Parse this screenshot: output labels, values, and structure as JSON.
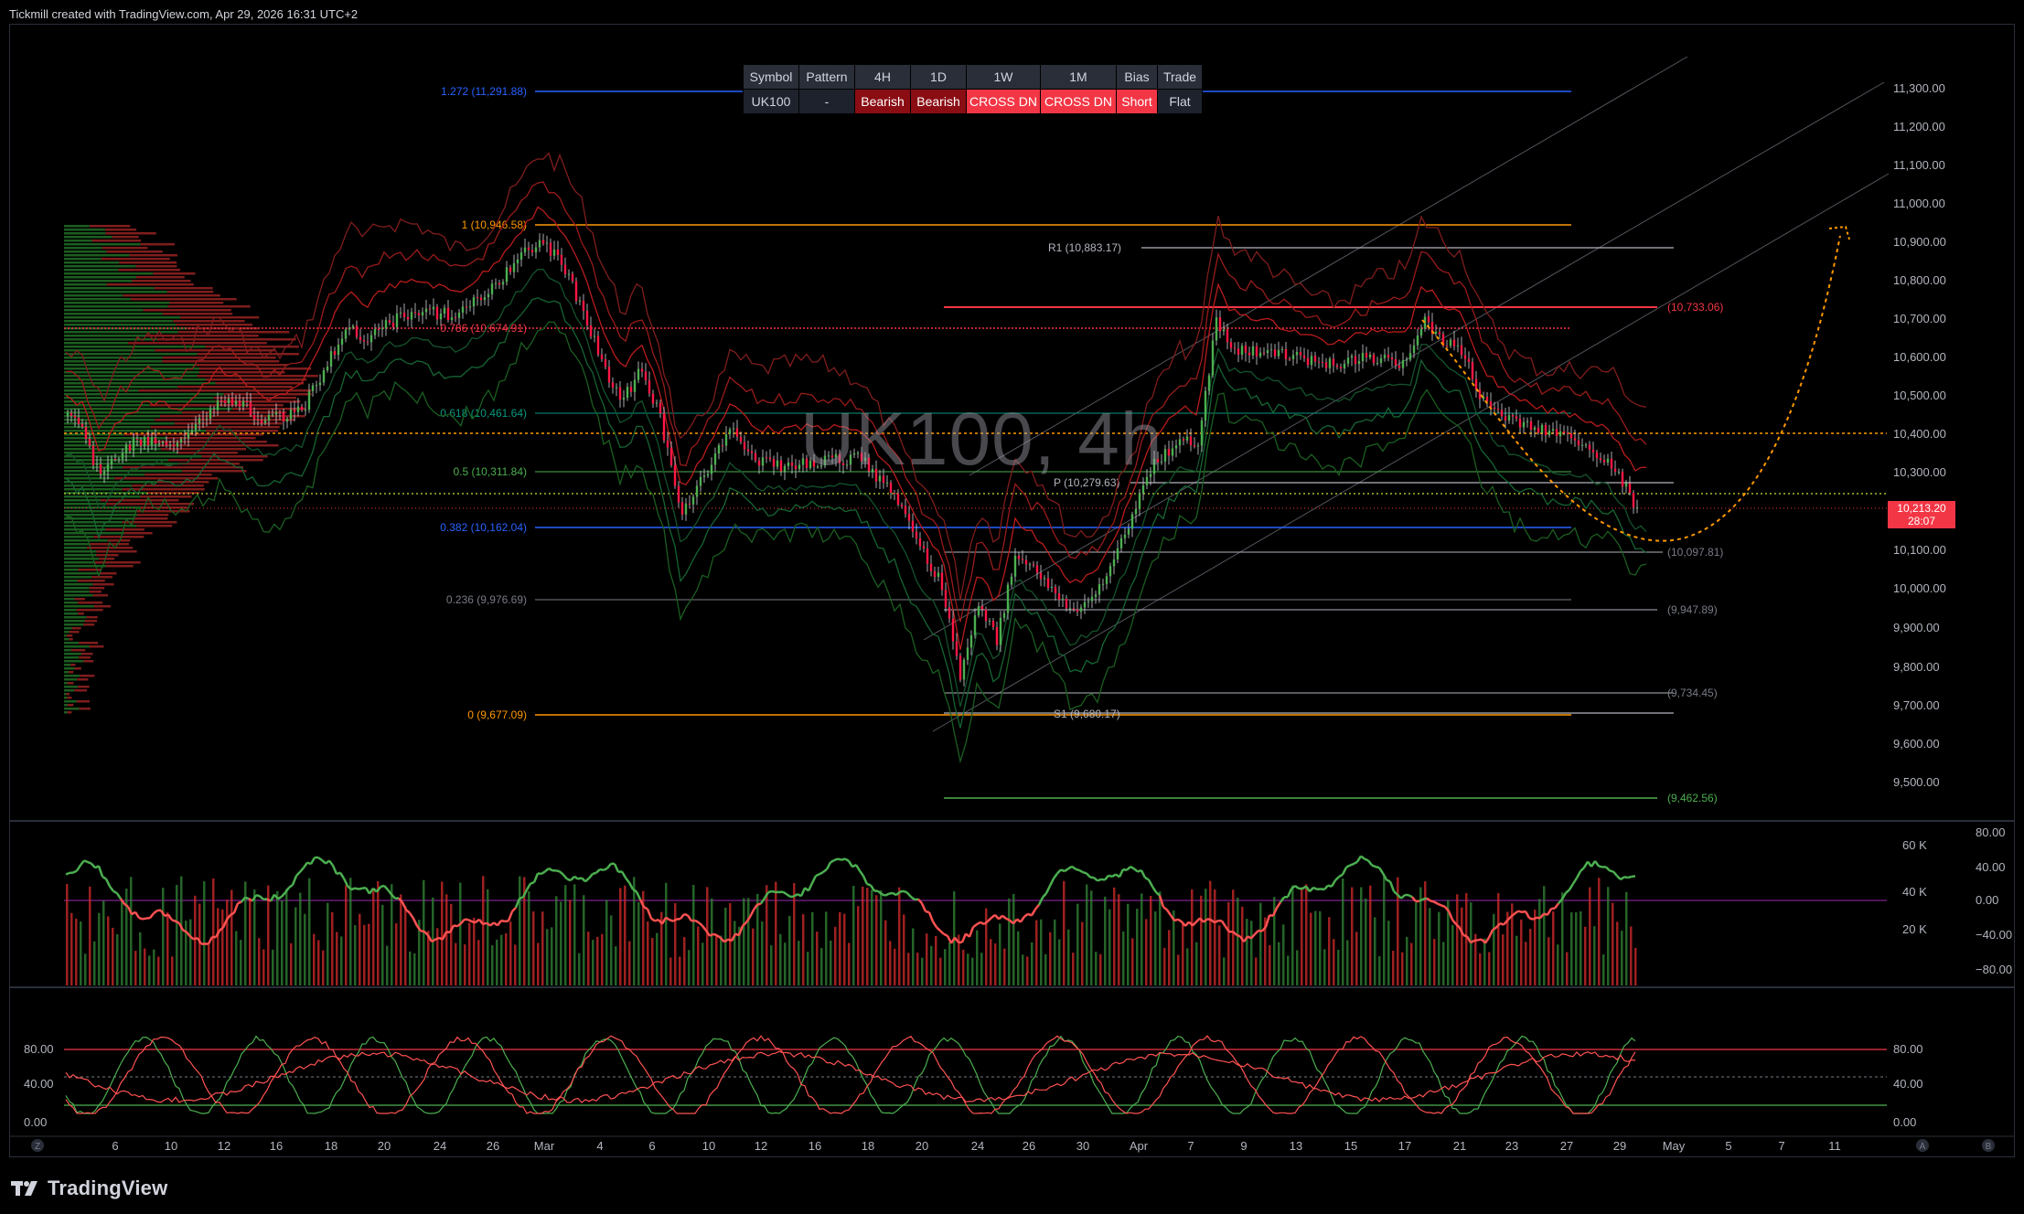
{
  "header": {
    "attribution": "Tickmill created with TradingView.com, Apr 29, 2026 16:31 UTC+2"
  },
  "watermark": {
    "symbol_tf": "UK100, 4h"
  },
  "status_table": {
    "headers": [
      "Symbol",
      "Pattern",
      "4H",
      "1D",
      "1W",
      "1M",
      "Bias",
      "Trade"
    ],
    "values": [
      "UK100",
      "-",
      "Bearish",
      "Bearish",
      "CROSS DN",
      "CROSS DN",
      "Short",
      "Flat"
    ]
  },
  "price_axis": {
    "labels": [
      "11,300.00",
      "11,200.00",
      "11,100.00",
      "11,000.00",
      "10,900.00",
      "10,800.00",
      "10,700.00",
      "10,600.00",
      "10,500.00",
      "10,400.00",
      "10,300.00",
      "10,100.00",
      "10,000.00",
      "9,900.00",
      "9,800.00",
      "9,700.00",
      "9,600.00",
      "9,500.00"
    ]
  },
  "last_price": {
    "value": "10,213.20",
    "countdown": "28:07",
    "color": "#f23645"
  },
  "fib_levels": [
    {
      "label": "1.272 (11,291.88)",
      "color": "#2962ff"
    },
    {
      "label": "1 (10,946.58)",
      "color": "#ff9800"
    },
    {
      "label": "0.786 (10,674.91)",
      "color": "#f23645"
    },
    {
      "label": "0.618 (10,461.64)",
      "color": "#089981"
    },
    {
      "label": "0.5 (10,311.84)",
      "color": "#4caf50"
    },
    {
      "label": "0.382 (10,162.04)",
      "color": "#2962ff"
    },
    {
      "label": "0.236 (9,976.69)",
      "color": "#787b86"
    },
    {
      "label": "0 (9,677.09)",
      "color": "#ff9800"
    }
  ],
  "pivots": {
    "r1": "R1 (10,883.17)",
    "p": "P (10,279.63)",
    "s1": "S1 (9,680.17)"
  },
  "levels_right": [
    "(10,733.06)",
    "(10,097.81)",
    "(9,947.89)",
    "(9,734.45)",
    "(9,462.56)"
  ],
  "volume_axis": {
    "labels": [
      "60 K",
      "40 K",
      "20 K"
    ]
  },
  "osc_axis": {
    "labels": [
      "80.00",
      "40.00",
      "0.00",
      "−40.00",
      "−80.00"
    ]
  },
  "stoch_axis": {
    "left": [
      "80.00",
      "40.00",
      "0.00"
    ],
    "right": [
      "80.00",
      "40.00",
      "0.00"
    ]
  },
  "time_axis": {
    "labels": [
      "6",
      "10",
      "12",
      "16",
      "18",
      "20",
      "24",
      "26",
      "Mar",
      "4",
      "6",
      "10",
      "12",
      "16",
      "18",
      "20",
      "24",
      "26",
      "30",
      "Apr",
      "7",
      "9",
      "13",
      "15",
      "17",
      "21",
      "23",
      "27",
      "29",
      "May",
      "5",
      "7",
      "11"
    ]
  },
  "brand": {
    "name": "TradingView"
  },
  "colors": {
    "bull": "#26a69a",
    "bear": "#ef5350",
    "up_line": "#4caf50",
    "down_line": "#ff5252",
    "projection": "#ff9800"
  }
}
